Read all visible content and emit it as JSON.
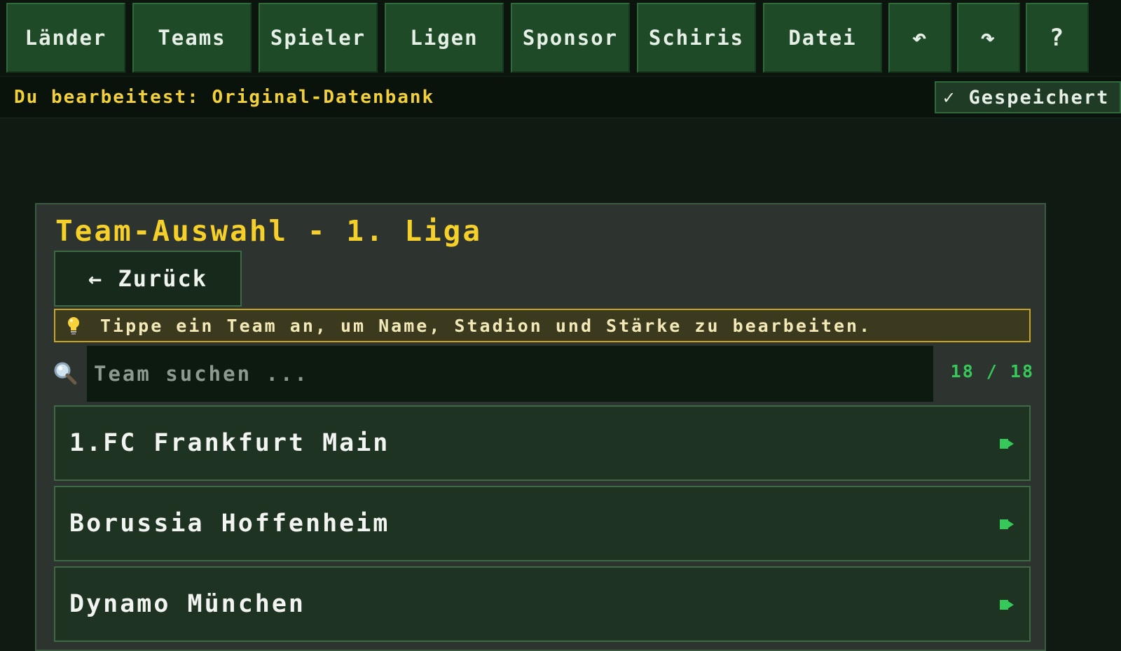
{
  "toolbar": {
    "buttons": [
      {
        "label": "Länder"
      },
      {
        "label": "Teams"
      },
      {
        "label": "Spieler"
      },
      {
        "label": "Ligen"
      },
      {
        "label": "Sponsor"
      },
      {
        "label": "Schiris"
      },
      {
        "label": "Datei"
      },
      {
        "label": "↶",
        "icon": "undo-icon"
      },
      {
        "label": "↷",
        "icon": "redo-icon"
      },
      {
        "label": "?",
        "icon": "help-icon"
      }
    ]
  },
  "status": {
    "editing_text": "Du bearbeitest: Original-Datenbank",
    "saved_label": "✓ Gespeichert"
  },
  "panel": {
    "title": "Team-Auswahl - 1. Liga",
    "back_label": "← Zurück",
    "hint_icon": "lightbulb-icon",
    "hint_text": "Tippe ein Team an, um Name, Stadion und Stärke zu bearbeiten.",
    "search_icon": "magnifier-icon",
    "search_placeholder": "Team suchen ...",
    "count": "18 / 18",
    "teams": [
      {
        "name": "1.FC Frankfurt Main"
      },
      {
        "name": "Borussia Hoffenheim"
      },
      {
        "name": "Dynamo München"
      }
    ]
  },
  "colors": {
    "accent_yellow": "#f5cf2a",
    "accent_green": "#37c85a",
    "button_green": "#1e4a28",
    "background": "#0f1a12"
  }
}
